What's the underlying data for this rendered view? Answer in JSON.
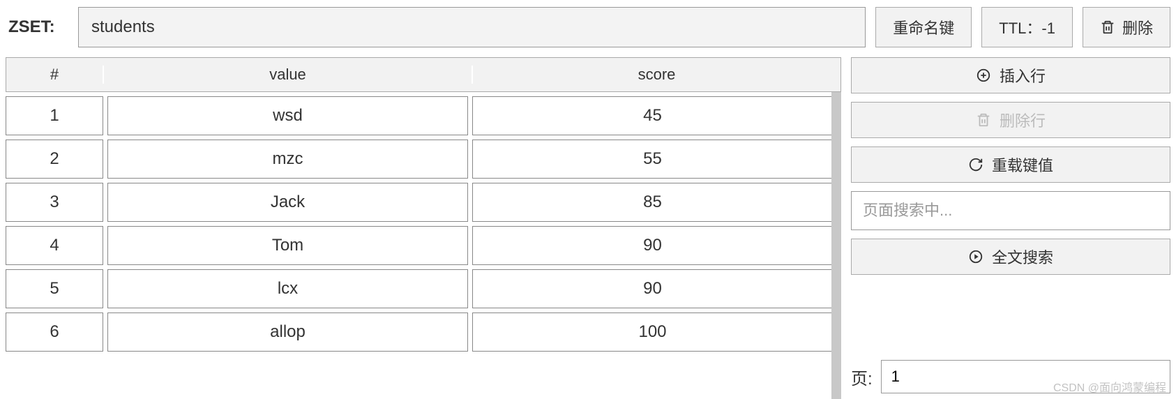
{
  "header": {
    "type_label": "ZSET:",
    "key_name": "students",
    "rename_label": "重命名键",
    "ttl_label": "TTL：-1",
    "delete_label": "删除"
  },
  "table": {
    "columns": {
      "index": "#",
      "value": "value",
      "score": "score"
    },
    "rows": [
      {
        "index": "1",
        "value": "wsd",
        "score": "45"
      },
      {
        "index": "2",
        "value": "mzc",
        "score": "55"
      },
      {
        "index": "3",
        "value": "Jack",
        "score": "85"
      },
      {
        "index": "4",
        "value": "Tom",
        "score": "90"
      },
      {
        "index": "5",
        "value": "lcx",
        "score": "90"
      },
      {
        "index": "6",
        "value": "allop",
        "score": "100"
      }
    ]
  },
  "sidebar": {
    "insert_row": "插入行",
    "delete_row": "删除行",
    "reload": "重载键值",
    "search_placeholder": "页面搜索中...",
    "fulltext_search": "全文搜索"
  },
  "pagination": {
    "label": "页:",
    "value": "1"
  },
  "watermark": "CSDN @面向鸿蒙编程"
}
